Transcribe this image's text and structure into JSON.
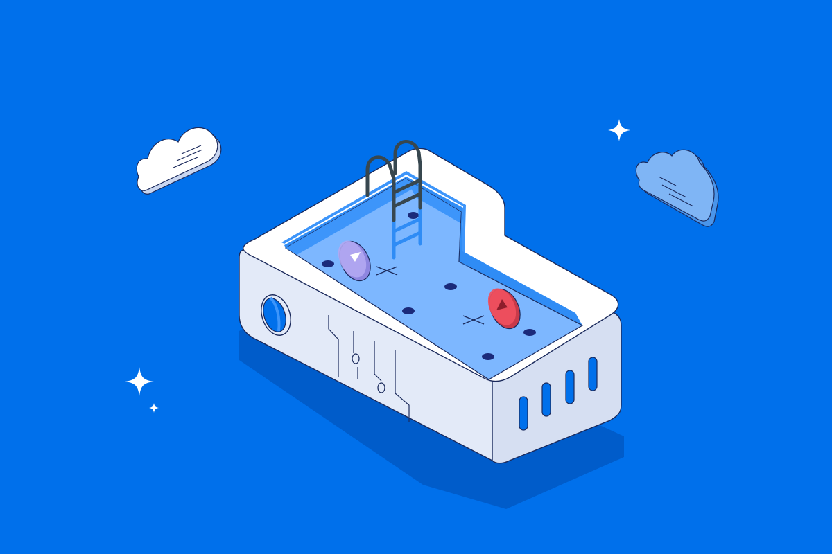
{
  "scene": {
    "background_color": "#0070EB",
    "accent_colors": {
      "pool_water": "#7DB7FF",
      "pool_wall": "#E3EAF8",
      "outline": "#1B2A5C",
      "ladder": "#37474F",
      "ladder_submerged": "#2F8CF5",
      "float_purple": "#B3A9F2",
      "float_red": "#F0505E",
      "cloud_white": "#EEF2FB",
      "cloud_blue": "#7FB5F5"
    },
    "elements": {
      "pool": "isometric-swimming-pool",
      "ladder": "pool-ladder",
      "floats": [
        "purple-pool-float",
        "red-pool-float"
      ],
      "clouds": [
        "white-cloud",
        "blue-cloud"
      ],
      "sparkles": [
        "sparkle-top-right",
        "sparkle-bottom-left-large",
        "sparkle-bottom-left-small"
      ]
    }
  }
}
